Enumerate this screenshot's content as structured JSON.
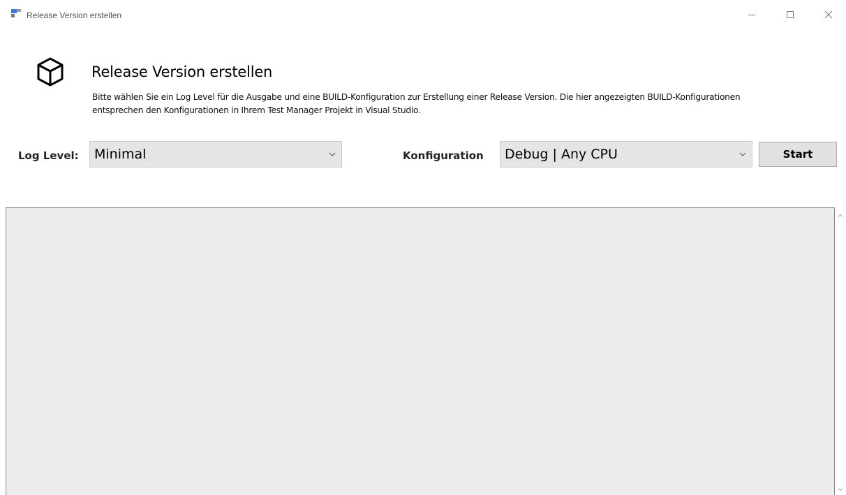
{
  "window": {
    "title": "Release Version erstellen",
    "icon": "app-window-icon",
    "controls": [
      "minimize-icon",
      "maximize-icon",
      "close-icon"
    ]
  },
  "header": {
    "icon": "cube-icon",
    "title": "Release Version erstellen",
    "description": "Bitte wählen Sie ein Log Level für die Ausgabe und eine BUILD-Konfiguration zur Erstellung einer Release Version. Die hier angezeigten BUILD-Konfigurationen entsprechen den Konfigurationen in Ihrem Test Manager Projekt in Visual Studio."
  },
  "form": {
    "log_level_label": "Log Level:",
    "log_level_value": "Minimal",
    "config_label": "Konfiguration",
    "config_value": "Debug | Any CPU",
    "start_label": "Start"
  },
  "output": {
    "text": ""
  },
  "colors": {
    "combo_bg": "#e5e5e5",
    "button_bg": "#e1e1e1",
    "output_bg": "#ececec"
  }
}
